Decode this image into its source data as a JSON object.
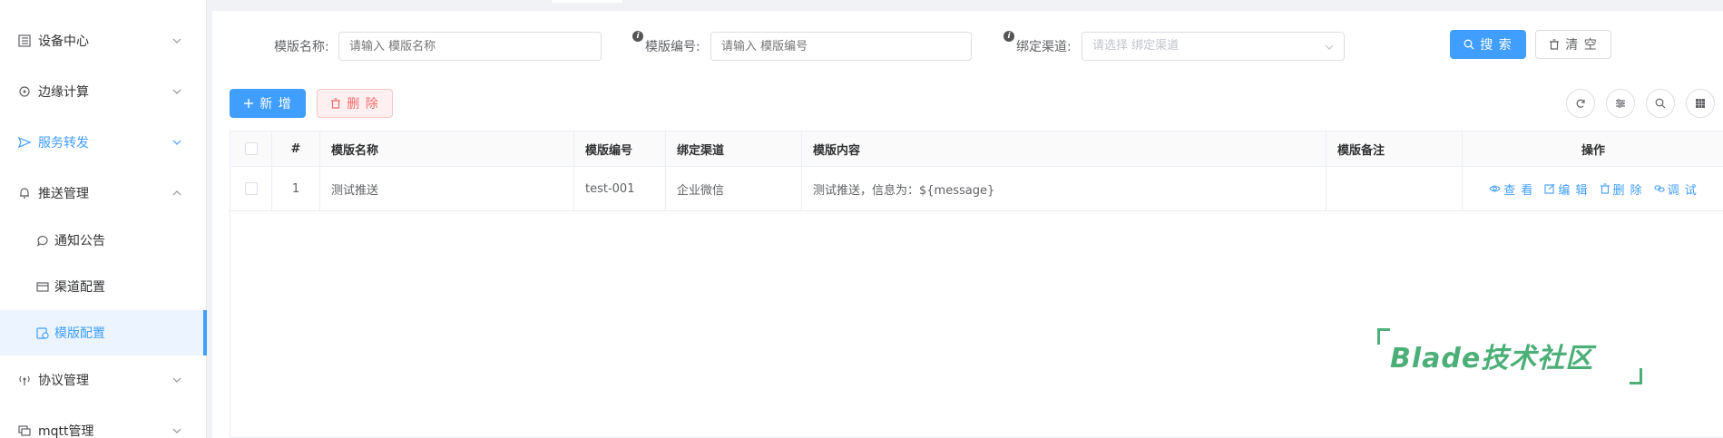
{
  "sidebar": {
    "items": [
      {
        "label": "设备中心",
        "icon": "device-list-icon",
        "expanded": false
      },
      {
        "label": "边缘计算",
        "icon": "edge-compute-icon",
        "expanded": false
      },
      {
        "label": "服务转发",
        "icon": "send-icon",
        "expanded": false,
        "highlighted": true
      },
      {
        "label": "推送管理",
        "icon": "bell-icon",
        "expanded": true
      },
      {
        "label": "协议管理",
        "icon": "antenna-icon",
        "expanded": false
      },
      {
        "label": "mqtt管理",
        "icon": "mqtt-icon",
        "expanded": false
      }
    ],
    "subitems": [
      {
        "label": "通知公告",
        "icon": "chat-bubble-icon"
      },
      {
        "label": "渠道配置",
        "icon": "channel-icon"
      },
      {
        "label": "模版配置",
        "icon": "template-icon",
        "active": true
      }
    ]
  },
  "search": {
    "name_label": "模版名称:",
    "name_placeholder": "请输入 模版名称",
    "code_label": "模版编号:",
    "code_placeholder": "请输入 模版编号",
    "channel_label": "绑定渠道:",
    "channel_placeholder": "请选择 绑定渠道",
    "search_button": "搜 索",
    "clear_button": "清 空"
  },
  "toolbar": {
    "add_button": "新 增",
    "delete_button": "删 除"
  },
  "table": {
    "columns": [
      "#",
      "模版名称",
      "模版编号",
      "绑定渠道",
      "模版内容",
      "模版备注",
      "操作"
    ],
    "rows": [
      {
        "index": "1",
        "name": "测试推送",
        "code": "test-001",
        "channel": "企业微信",
        "content": "测试推送，信息为：${message}",
        "remark": ""
      }
    ],
    "actions": {
      "view": "查 看",
      "edit": "编 辑",
      "delete": "删 除",
      "debug": "调 试"
    }
  },
  "watermark": {
    "text": "Blade技术社区"
  },
  "colors": {
    "primary": "#409eff",
    "danger": "#f56c6c",
    "watermark": "#4caf78",
    "active_bg": "#ecf5ff"
  }
}
